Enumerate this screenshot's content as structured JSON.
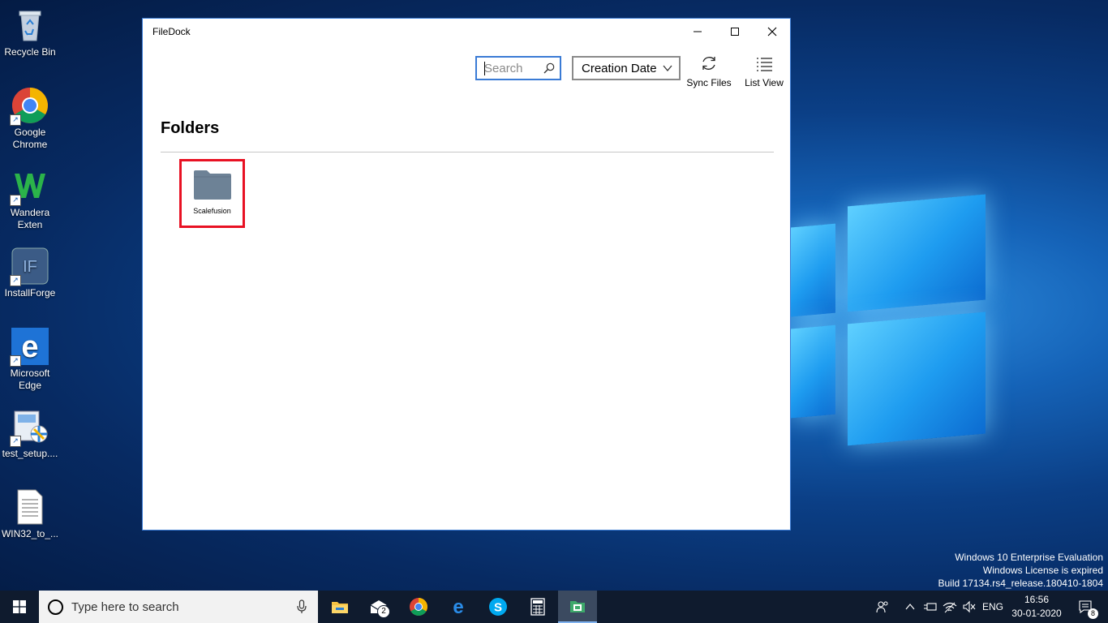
{
  "desktop": {
    "icons": [
      {
        "label": "Recycle Bin"
      },
      {
        "label": "Google Chrome"
      },
      {
        "label": "Wandera Exten"
      },
      {
        "label": "InstallForge"
      },
      {
        "label": "Microsoft Edge"
      },
      {
        "label": "test_setup...."
      },
      {
        "label": "WIN32_to_..."
      }
    ],
    "watermark": {
      "line1": "Windows 10 Enterprise Evaluation",
      "line2": "Windows License is expired",
      "line3": "Build 17134.rs4_release.180410-1804"
    }
  },
  "window": {
    "title": "FileDock",
    "search": {
      "placeholder": "Search",
      "value": ""
    },
    "sort_dropdown": {
      "selected": "Creation Date"
    },
    "sync_label": "Sync Files",
    "view_label": "List View",
    "section_title": "Folders",
    "folders": [
      {
        "name": "Scalefusion"
      }
    ],
    "highlight_color": "#e81123"
  },
  "taskbar": {
    "search_placeholder": "Type here to search",
    "mail_badge": "2",
    "language": "ENG",
    "time": "16:56",
    "date": "30-01-2020",
    "notification_count": "8"
  }
}
